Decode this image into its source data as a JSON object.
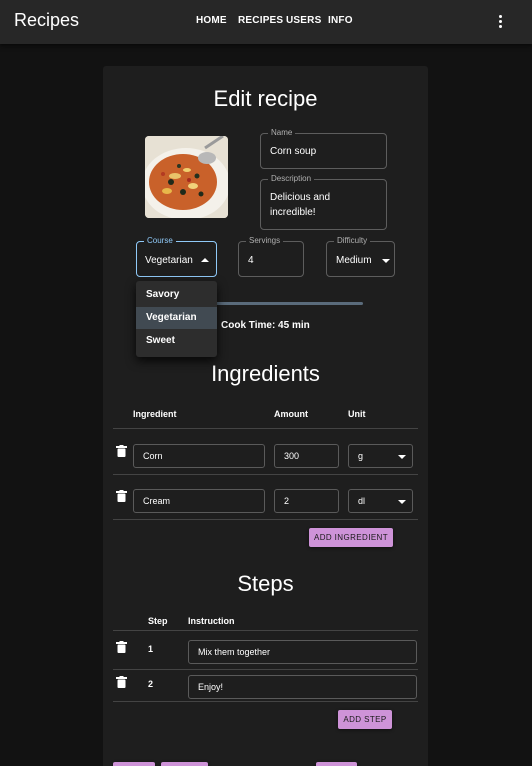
{
  "appbar": {
    "title": "Recipes",
    "nav": [
      "HOME",
      "RECIPES",
      "USERS",
      "INFO"
    ],
    "more_icon": "more-vert-icon"
  },
  "page": {
    "title": "Edit recipe",
    "image_alt": "bowl-of-soup-image",
    "name": {
      "label": "Name",
      "value": "Corn soup"
    },
    "description": {
      "label": "Description",
      "value_line1": "Delicious and",
      "value_line2": "incredible!"
    },
    "course": {
      "label": "Course",
      "value": "Vegetarian",
      "options": [
        "Savory",
        "Vegetarian",
        "Sweet"
      ],
      "selected_index": 1
    },
    "servings": {
      "label": "Servings",
      "value": "4"
    },
    "difficulty": {
      "label": "Difficulty",
      "value": "Medium"
    },
    "cook_time": "Cook Time: 45 min"
  },
  "ingredients": {
    "title": "Ingredients",
    "headers": [
      "Ingredient",
      "Amount",
      "Unit"
    ],
    "rows": [
      {
        "name": "Corn",
        "amount": "300",
        "unit": "g"
      },
      {
        "name": "Cream",
        "amount": "2",
        "unit": "dl"
      }
    ],
    "add_label": "ADD INGREDIENT"
  },
  "steps": {
    "title": "Steps",
    "headers": [
      "Step",
      "Instruction"
    ],
    "rows": [
      {
        "step": "1",
        "instruction": "Mix them together"
      },
      {
        "step": "2",
        "instruction": "Enjoy!"
      }
    ],
    "add_label": "ADD STEP"
  },
  "colors": {
    "accent": "#ce93d8",
    "focus": "#90caf9",
    "appbar": "#272727",
    "card": "#1e1e1e"
  }
}
